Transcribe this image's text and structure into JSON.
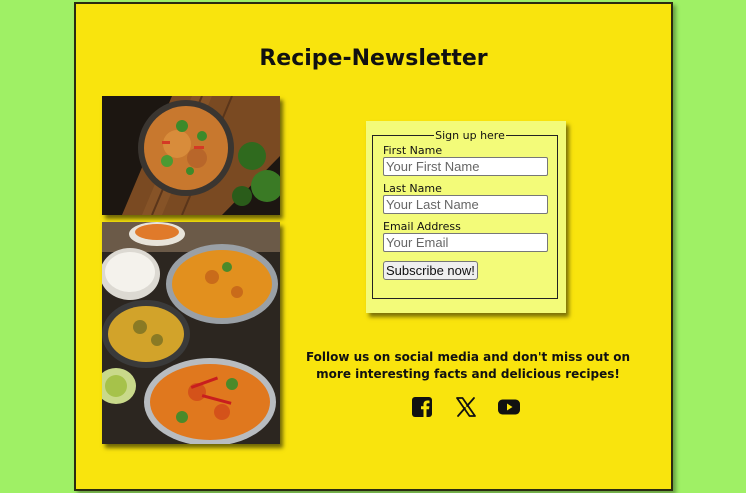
{
  "page": {
    "title": "Recipe-Newsletter"
  },
  "images": [
    {
      "name": "curry-bowl-photo"
    },
    {
      "name": "curry-spread-photo"
    }
  ],
  "form": {
    "legend": "Sign up here",
    "first_name": {
      "label": "First Name",
      "placeholder": "Your First Name",
      "value": ""
    },
    "last_name": {
      "label": "Last Name",
      "placeholder": "Your Last Name",
      "value": ""
    },
    "email": {
      "label": "Email Address",
      "placeholder": "Your Email",
      "value": ""
    },
    "submit_label": "Subscribe now!"
  },
  "social": {
    "text": "Follow us on social media and don't miss out on more interesting facts and delicious recipes!",
    "icons": [
      "facebook-icon",
      "x-icon",
      "youtube-icon"
    ]
  },
  "colors": {
    "background": "#9ff065",
    "card": "#f9e40d",
    "form": "#f3fb79"
  }
}
